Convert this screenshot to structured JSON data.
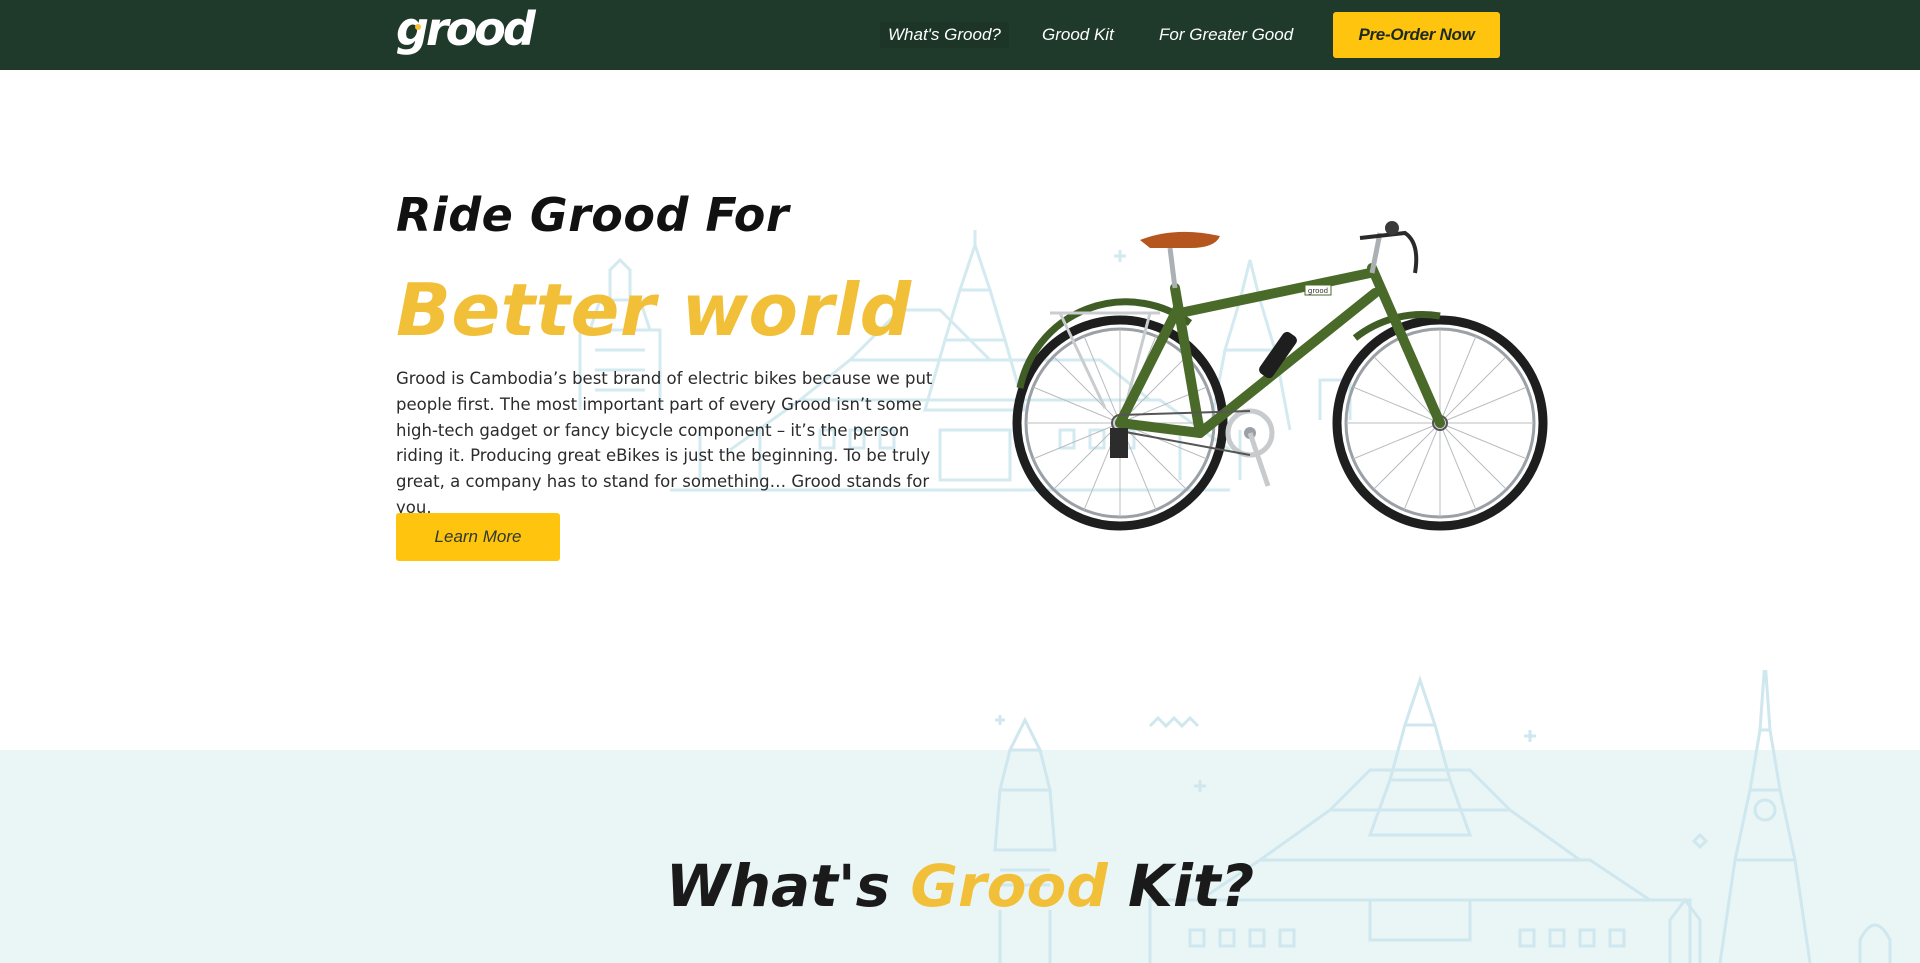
{
  "header": {
    "logo_text": "grood",
    "nav": [
      {
        "label": "What's Grood?"
      },
      {
        "label": "Grood Kit"
      },
      {
        "label": "For Greater Good"
      }
    ],
    "cta_label": "Pre-Order Now"
  },
  "hero": {
    "title": "Ride Grood For",
    "subtitle": "Better world",
    "body": "Grood is Cambodia’s best brand of electric bikes because we put people first. The most important part of every Grood isn’t some high-tech gadget or fancy bicycle component – it’s the person riding it. Producing great eBikes is just the beginning. To be truly great, a company has to stand for something… Grood stands for you.",
    "button_label": "Learn More",
    "bike_badge": "grood"
  },
  "kit_section": {
    "title_prefix": "What's ",
    "title_highlight": "Grood",
    "title_suffix": " Kit?"
  },
  "colors": {
    "header_bg": "#1f3a2b",
    "accent_yellow": "#fec40e",
    "headline_yellow": "#f2c038",
    "section_bg": "#eaf5f6",
    "temple_line": "#cfe9ee",
    "bike_frame": "#4a6a2a"
  },
  "icons": {
    "logo": "grood-logo",
    "hero_image": "bicycle-image",
    "background": "temple-outline-illustration"
  }
}
